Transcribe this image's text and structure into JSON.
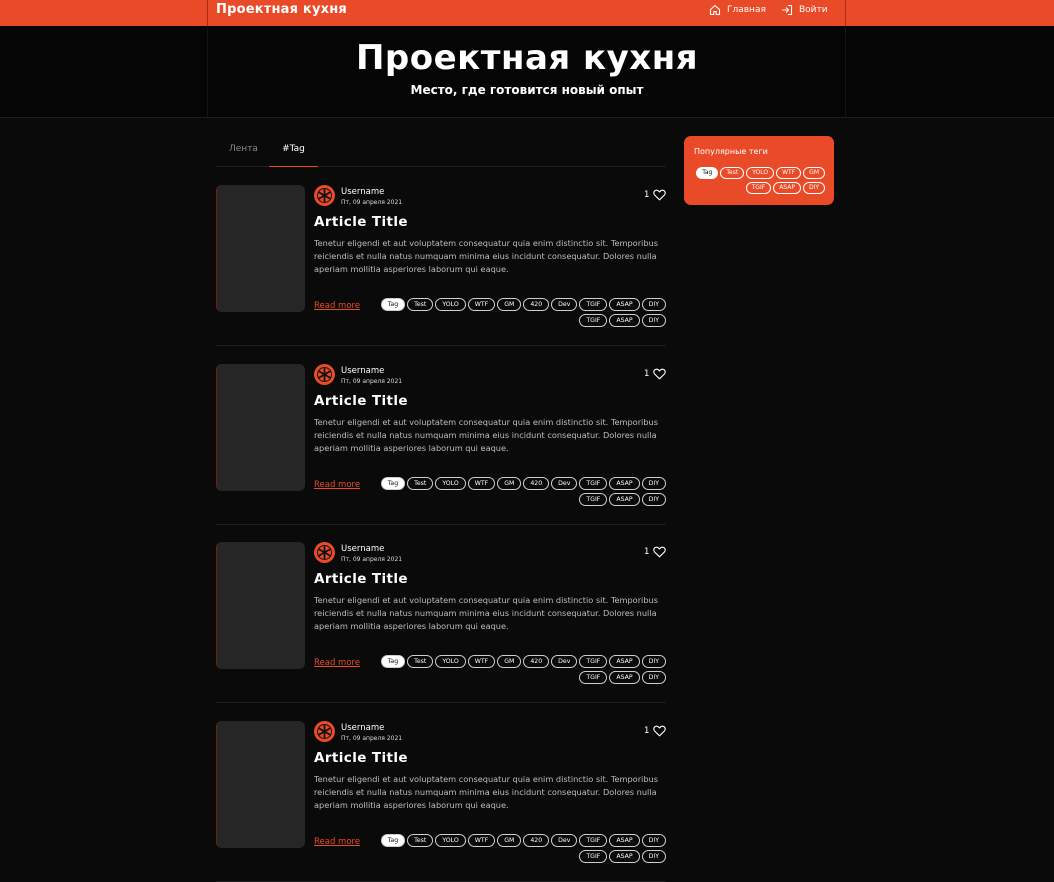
{
  "topbar": {
    "brand": "Проектная кухня",
    "nav_home": "Главная",
    "nav_login": "Войти"
  },
  "hero": {
    "title": "Проектная кухня",
    "subtitle": "Место, где готовится новый опыт"
  },
  "tabs": [
    {
      "label": "Лента",
      "active": false
    },
    {
      "label": "#Tag",
      "active": true
    }
  ],
  "articles": [
    {
      "username": "Username",
      "date": "Пт, 09 апреля 2021",
      "likes": "1",
      "title": "Article Title",
      "excerpt": "Tenetur eligendi et aut voluptatem consequatur quia enim distinctio sit. Temporibus reiciendis et nulla natus numquam minima eius incidunt consequatur. Dolores nulla aperiam mollitia asperiores laborum qui eaque.",
      "read_more": "Read more",
      "tags_row1": [
        "Tag",
        "Test",
        "YOLO",
        "WTF",
        "GM",
        "420",
        "Dev",
        "TGIF",
        "ASAP",
        "DIY"
      ],
      "tags_row2": [
        "TGIF",
        "ASAP",
        "DIY"
      ]
    },
    {
      "username": "Username",
      "date": "Пт, 09 апреля 2021",
      "likes": "1",
      "title": "Article Title",
      "excerpt": "Tenetur eligendi et aut voluptatem consequatur quia enim distinctio sit. Temporibus reiciendis et nulla natus numquam minima eius incidunt consequatur. Dolores nulla aperiam mollitia asperiores laborum qui eaque.",
      "read_more": "Read more",
      "tags_row1": [
        "Tag",
        "Test",
        "YOLO",
        "WTF",
        "GM",
        "420",
        "Dev",
        "TGIF",
        "ASAP",
        "DIY"
      ],
      "tags_row2": [
        "TGIF",
        "ASAP",
        "DIY"
      ]
    },
    {
      "username": "Username",
      "date": "Пт, 09 апреля 2021",
      "likes": "1",
      "title": "Article Title",
      "excerpt": "Tenetur eligendi et aut voluptatem consequatur quia enim distinctio sit. Temporibus reiciendis et nulla natus numquam minima eius incidunt consequatur. Dolores nulla aperiam mollitia asperiores laborum qui eaque.",
      "read_more": "Read more",
      "tags_row1": [
        "Tag",
        "Test",
        "YOLO",
        "WTF",
        "GM",
        "420",
        "Dev",
        "TGIF",
        "ASAP",
        "DIY"
      ],
      "tags_row2": [
        "TGIF",
        "ASAP",
        "DIY"
      ]
    },
    {
      "username": "Username",
      "date": "Пт, 09 апреля 2021",
      "likes": "1",
      "title": "Article Title",
      "excerpt": "Tenetur eligendi et aut voluptatem consequatur quia enim distinctio sit. Temporibus reiciendis et nulla natus numquam minima eius incidunt consequatur. Dolores nulla aperiam mollitia asperiores laborum qui eaque.",
      "read_more": "Read more",
      "tags_row1": [
        "Tag",
        "Test",
        "YOLO",
        "WTF",
        "GM",
        "420",
        "Dev",
        "TGIF",
        "ASAP",
        "DIY"
      ],
      "tags_row2": [
        "TGIF",
        "ASAP",
        "DIY"
      ]
    }
  ],
  "active_tag": "Tag",
  "popular": {
    "title": "Популярные теги",
    "tags_row1": [
      "Tag",
      "Test",
      "YOLO",
      "WTF",
      "GM"
    ],
    "tags_row2": [
      "TGIF",
      "ASAP",
      "DIY"
    ]
  },
  "colors": {
    "accent": "#e94b28",
    "background": "#0a0a0a",
    "thumb": "#262626"
  },
  "icons": {
    "home": "home-icon",
    "login": "login-icon",
    "avatar": "asterisk-avatar-icon",
    "like": "heart-icon"
  }
}
